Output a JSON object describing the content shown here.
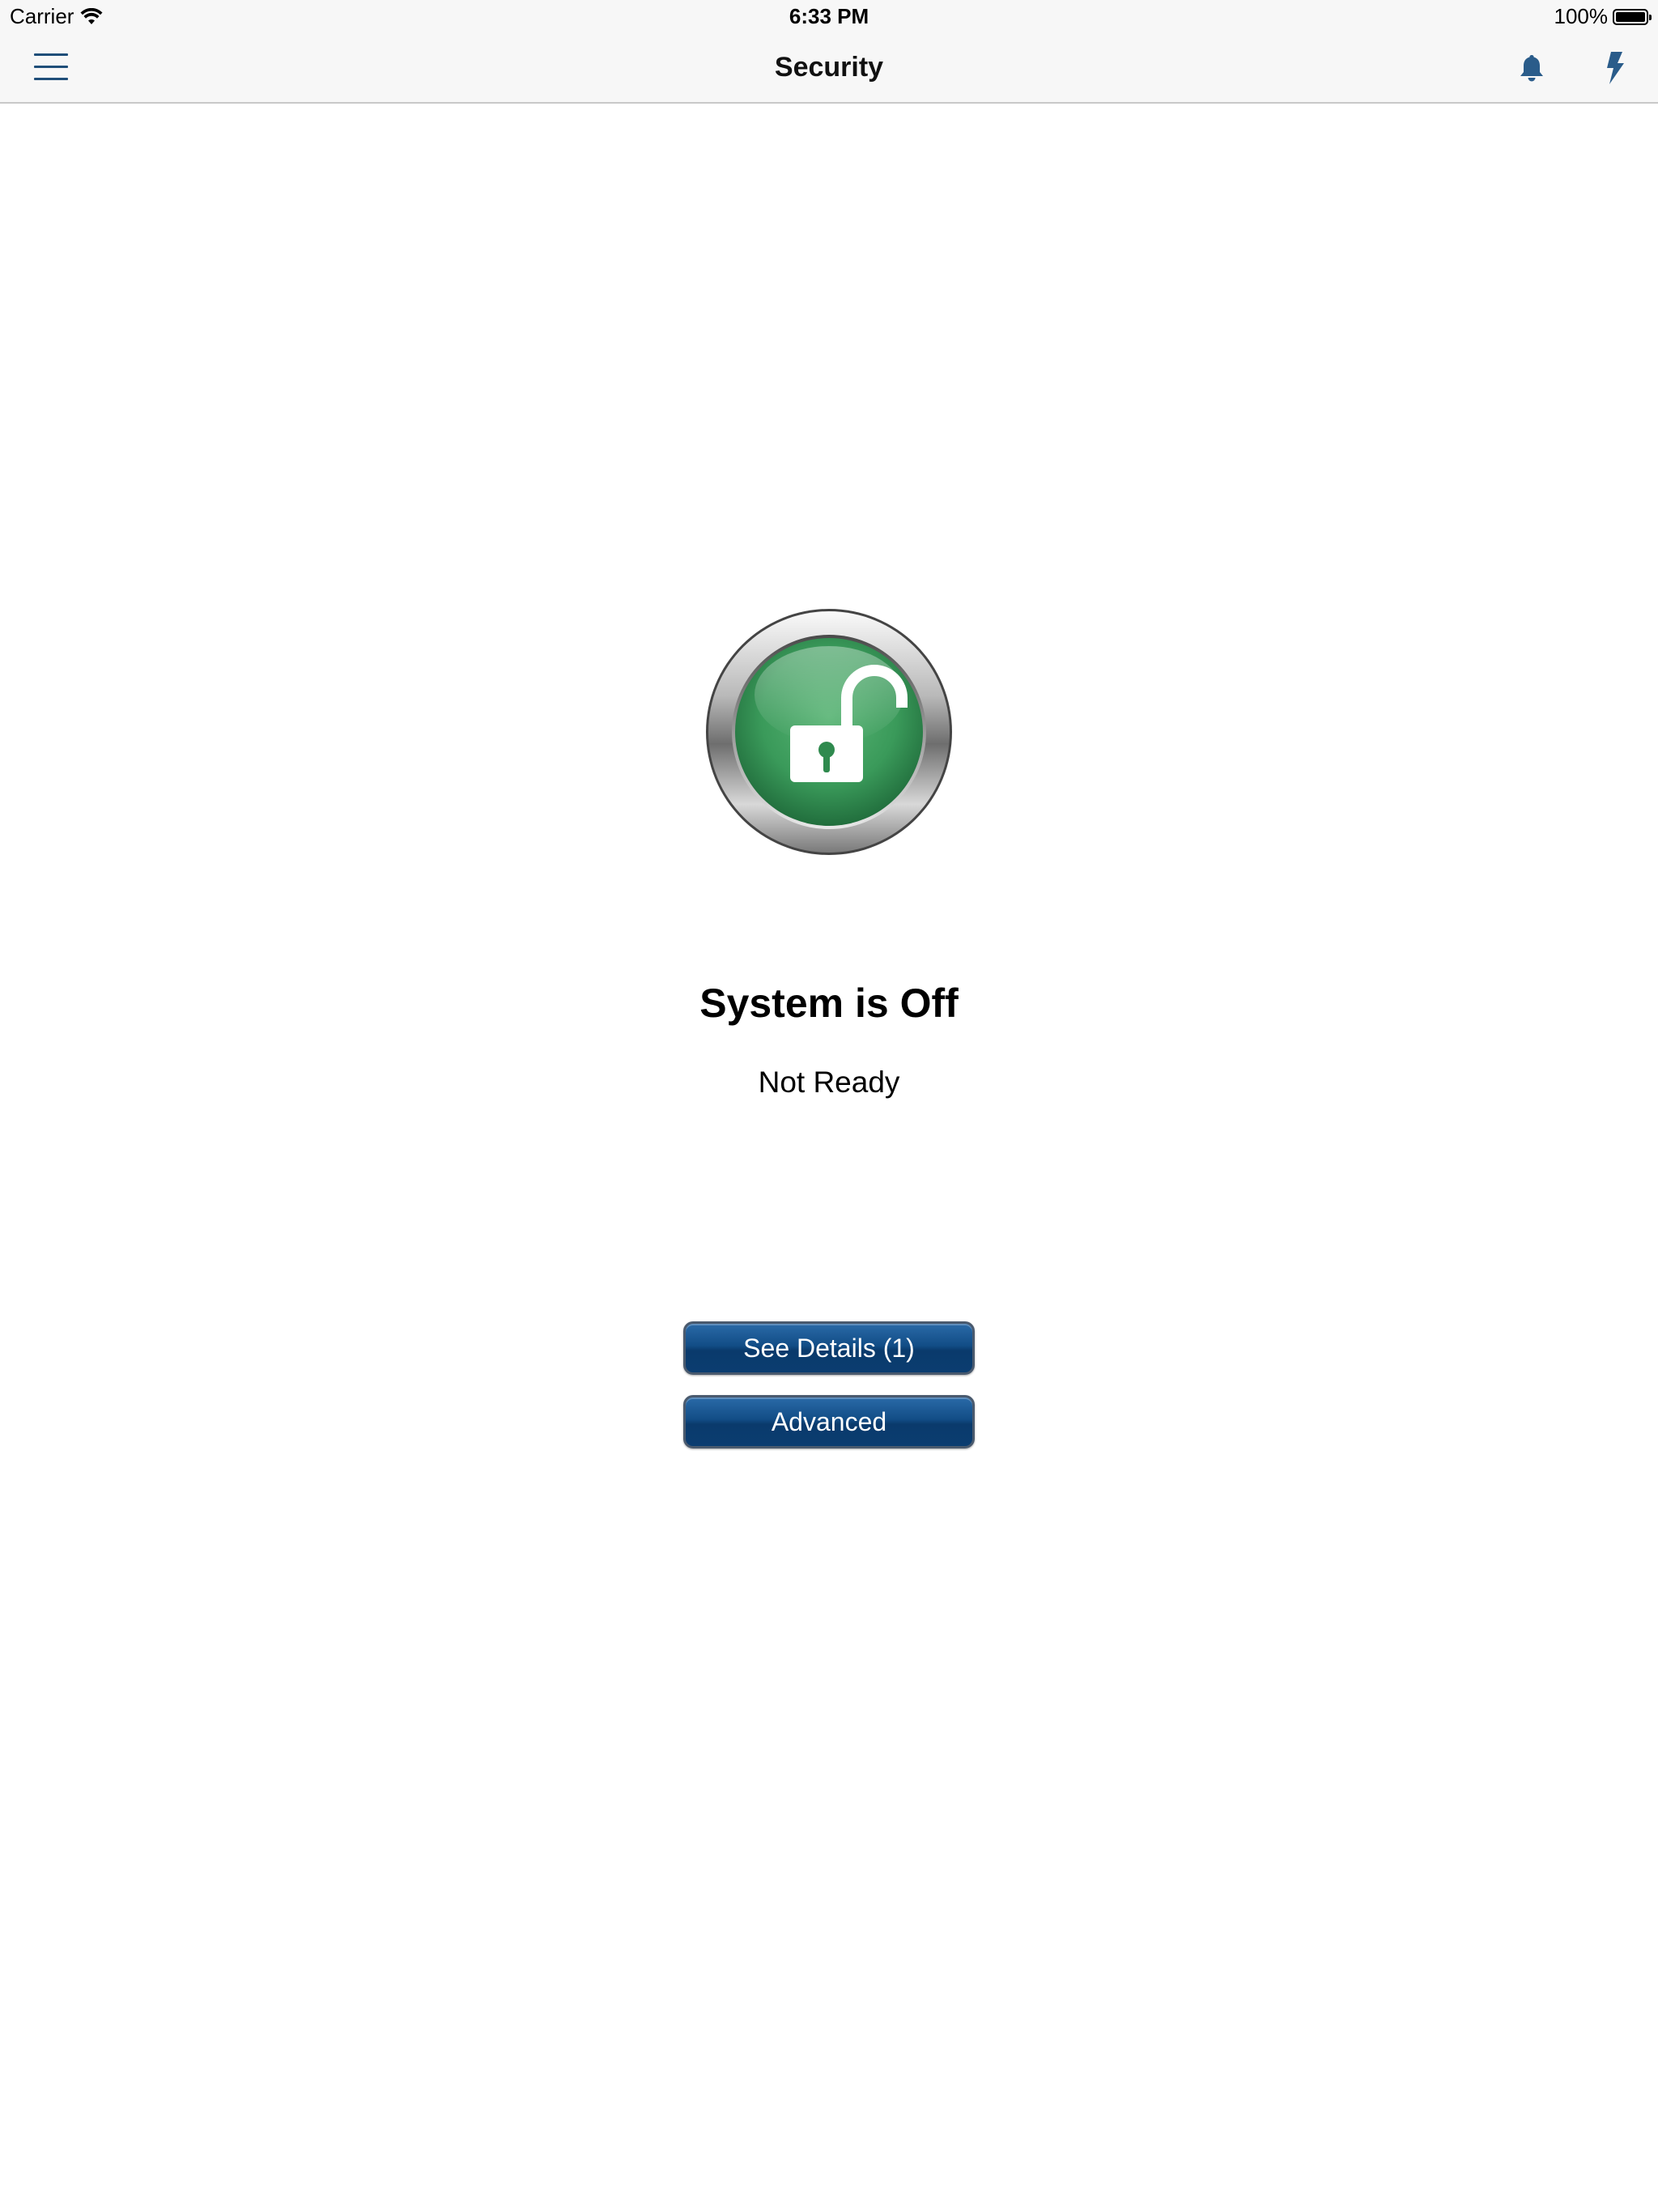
{
  "status_bar": {
    "carrier": "Carrier",
    "time": "6:33 PM",
    "battery": "100%"
  },
  "nav": {
    "title": "Security",
    "icons": [
      "menu-icon",
      "bell-icon",
      "bolt-icon"
    ],
    "icon_color": "#1f4e79"
  },
  "security": {
    "status_title": "System is Off",
    "status_subtitle": "Not Ready",
    "lock_icon": "unlocked-padlock-icon",
    "lock_color": "#3a9a5a"
  },
  "buttons": {
    "details_label": "See Details (1)",
    "advanced_label": "Advanced",
    "button_color": "#0b3d70"
  }
}
